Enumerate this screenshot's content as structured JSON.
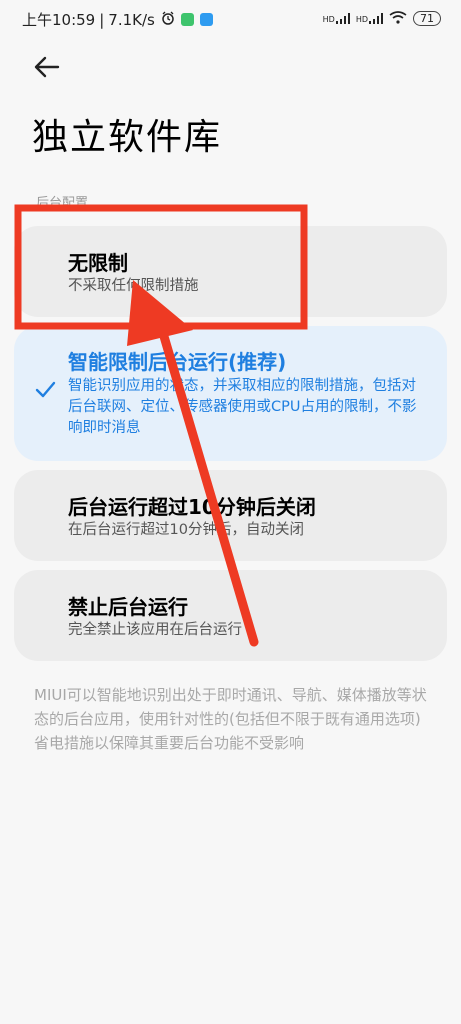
{
  "status": {
    "time": "上午10:59",
    "speed": "7.1K/s",
    "signal1": "HD",
    "signal2": "HD",
    "battery": "71"
  },
  "header": {
    "title": "独立软件库",
    "section_label": "后台配置"
  },
  "options": [
    {
      "title": "无限制",
      "desc": "不采取任何限制措施"
    },
    {
      "title": "智能限制后台运行(推荐)",
      "desc": "智能识别应用的状态，并采取相应的限制措施，包括对后台联网、定位、传感器使用或CPU占用的限制，不影响即时消息"
    },
    {
      "title": "后台运行超过10分钟后关闭",
      "desc": "在后台运行超过10分钟后，自动关闭"
    },
    {
      "title": "禁止后台运行",
      "desc": "完全禁止该应用在后台运行"
    }
  ],
  "footer": "MIUI可以智能地识别出处于即时通讯、导航、媒体播放等状态的后台应用，使用针对性的(包括但不限于既有通用选项)省电措施以保障其重要后台功能不受影响",
  "colors": {
    "accent": "#1f7fe0",
    "annotation": "#ee3a23"
  },
  "icons": [
    "back-arrow-icon",
    "check-icon",
    "alarm-icon",
    "wifi-icon"
  ]
}
